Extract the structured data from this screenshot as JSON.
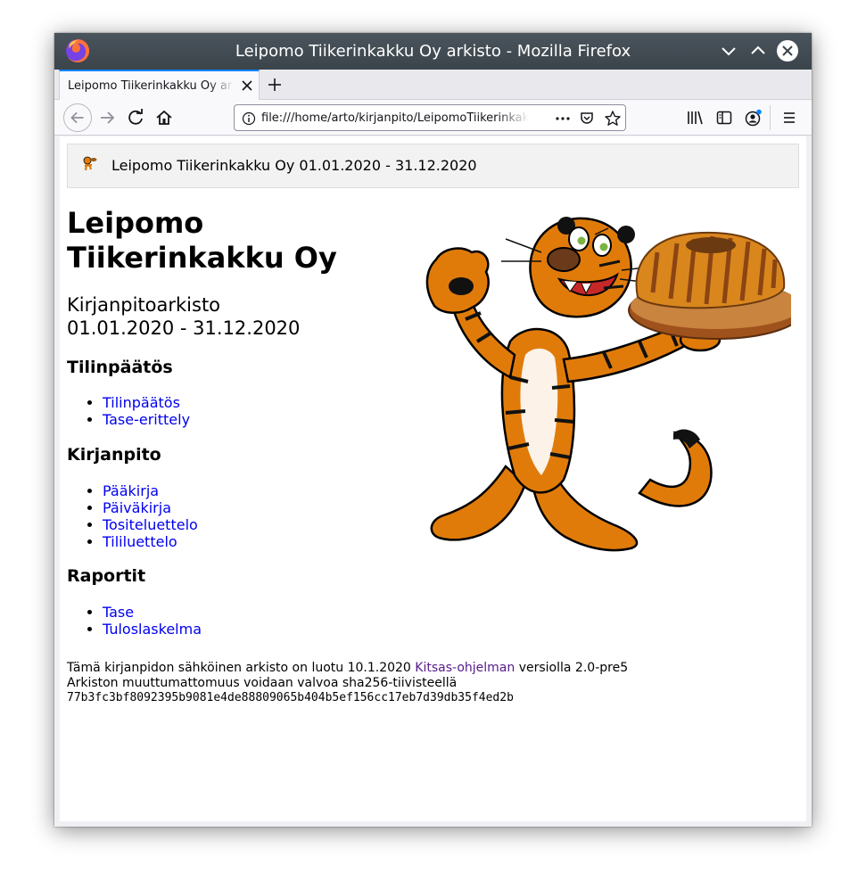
{
  "window": {
    "title": "Leipomo Tiikerinkakku Oy arkisto - Mozilla Firefox"
  },
  "tab": {
    "label": "Leipomo Tiikerinkakku Oy arkisto"
  },
  "urlbar": {
    "url": "file:///home/arto/kirjanpito/LeipomoTiikerinkakku"
  },
  "page": {
    "header": "Leipomo Tiikerinkakku Oy 01.01.2020 - 31.12.2020",
    "company_line1": "Leipomo",
    "company_line2": "Tiikerinkakku Oy",
    "subtitle_line1": "Kirjanpitoarkisto",
    "subtitle_line2": "01.01.2020 - 31.12.2020",
    "sections": [
      {
        "heading": "Tilinpäätös",
        "links": [
          "Tilinpäätös",
          "Tase-erittely"
        ]
      },
      {
        "heading": "Kirjanpito",
        "links": [
          "Pääkirja",
          "Päiväkirja",
          "Tositeluettelo",
          "Tililuettelo"
        ]
      },
      {
        "heading": "Raportit",
        "links": [
          "Tase",
          "Tuloslaskelma"
        ]
      }
    ],
    "footer": {
      "line1_prefix": "Tämä kirjanpidon sähköinen arkisto on luotu 10.1.2020",
      "line1_link": "Kitsas-ohjelman",
      "line1_suffix": "versiolla 2.0-pre5",
      "line2": "Arkiston muuttumattomuus voidaan valvoa sha256-tiivisteellä",
      "hash": "77b3fc3bf8092395b9081e4de88809065b404b5ef156cc17eb7d39db35f4ed2b"
    }
  },
  "colors": {
    "titlebar": "#3b444b",
    "tab_accent": "#0a84ff",
    "link": "#0000ee",
    "visited_link": "#551a8b",
    "tiger_orange": "#e07b0a"
  }
}
